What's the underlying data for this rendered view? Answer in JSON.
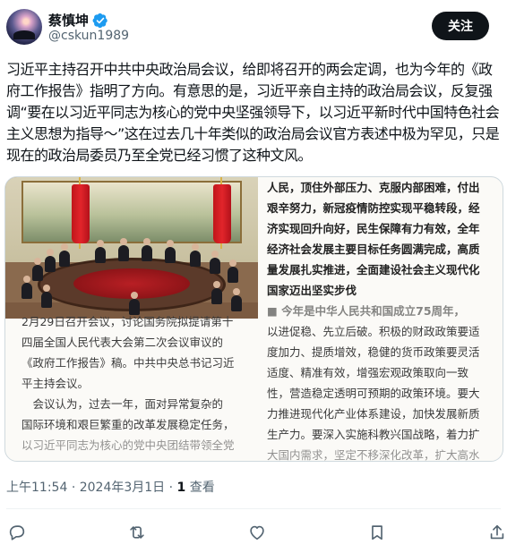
{
  "author": {
    "display_name": "蔡慎坤",
    "handle": "@cskun1989",
    "verified": true
  },
  "follow_label": "关注",
  "tweet_text": "习近平主持召开中共中央政治局会议，给即将召开的两会定调，也为今年的《政府工作报告》指明了方向。有意思的是，习近平亲自主持的政治局会议，反复强调“要在以习近平同志为核心的党中央坚强领导下，以习近平新时代中国特色社会主义思想为指导～”这在过去几十年类似的政治局会议官方表述中极为罕见，只是现在的政治局委员乃至全党已经习惯了这种文风。",
  "media": {
    "right_column": [
      "人民，顶住外部压力、克服内部困难，付出",
      "艰辛努力，新冠疫情防控实现平稳转段，经",
      "济实现回升向好，民生保障有力有效，全年",
      "经济社会发展主要目标任务圆满完成，高质",
      "量发展扎实推进，全面建设社会主义现代化",
      "国家迈出坚实步伐",
      "■ 今年是中华人民共和国成立75周年，",
      "以进促稳、先立后破。积极的财政政策要适",
      "度加力、提质增效，稳健的货币政策要灵活",
      "适度、精准有效，增强宏观政策取向一致",
      "性，营造稳定透明可预期的政策环境。要大",
      "力推进现代化产业体系建设，加快发展新质",
      "生产力。要深入实施科教兴国战略，着力扩",
      "大国内需求，坚定不移深化改革，扩大高水"
    ],
    "left_column": [
      "2月29日召开会议，讨论国务院拟提请第十",
      "四届全国人民代表大会第二次会议审议的",
      "《政府工作报告》稿。中共中央总书记习近",
      "平主持会议。",
      "　会议认为，过去一年，面对异常复杂的",
      "国际环境和艰巨繁重的改革发展稳定任务，",
      "以习近平同志为核心的党中央团结带领全党"
    ]
  },
  "meta": {
    "time": "上午11:54",
    "separator": "·",
    "date": "2024年3月1日",
    "views_count": "1",
    "views_label": "查看"
  },
  "actions": {
    "reply_icon": "reply-icon",
    "repost_icon": "repost-icon",
    "like_icon": "like-icon",
    "bookmark_icon": "bookmark-icon",
    "share_icon": "share-icon"
  },
  "colors": {
    "text": "#0f1419",
    "secondary": "#536471",
    "verified": "#1d9bf0",
    "follow_bg": "#0f1419"
  }
}
